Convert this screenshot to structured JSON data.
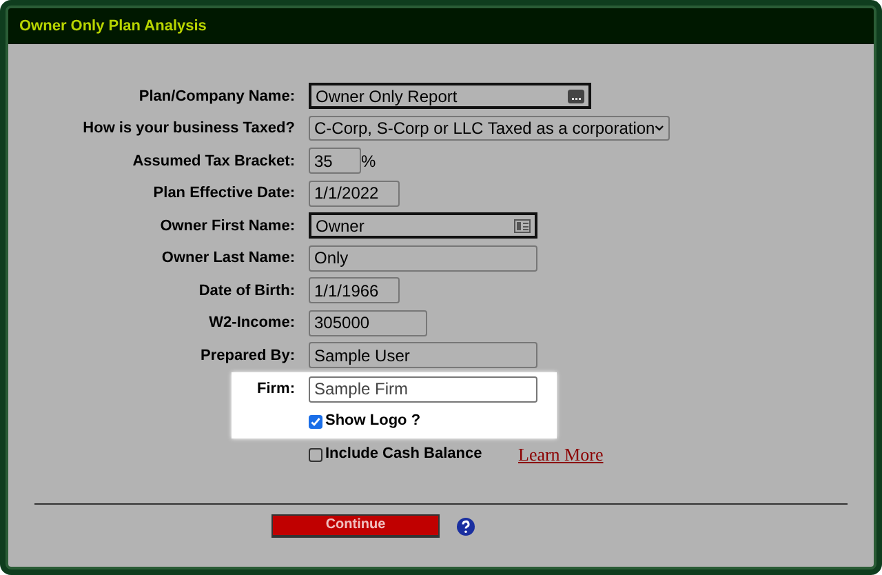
{
  "window": {
    "title": "Owner Only Plan Analysis"
  },
  "fields": [
    {
      "kind": "autofill",
      "label": "Plan/Company Name:",
      "value": "Owner Only Report",
      "highlighted": false
    },
    {
      "kind": "select",
      "label": "How is your business Taxed?",
      "value": "C-Corp, S-Corp or LLC Taxed as a corporation",
      "highlighted": false
    },
    {
      "kind": "text",
      "label": "Assumed Tax Bracket:",
      "value": "35",
      "suffix": "%",
      "highlighted": false
    },
    {
      "kind": "text",
      "label": "Plan Effective Date:",
      "value": "1/1/2022",
      "highlighted": false
    },
    {
      "kind": "contact",
      "label": "Owner First Name:",
      "value": "Owner",
      "highlighted": false
    },
    {
      "kind": "text",
      "label": "Owner Last Name:",
      "value": "Only",
      "highlighted": false
    },
    {
      "kind": "text",
      "label": "Date of Birth:",
      "value": "1/1/1966",
      "highlighted": false
    },
    {
      "kind": "text",
      "label": "W2-Income:",
      "value": "305000",
      "highlighted": false
    },
    {
      "kind": "text",
      "label": "Prepared By:",
      "value": "Sample User",
      "highlighted": false
    },
    {
      "kind": "text",
      "label": "Firm:",
      "value": "Sample Firm",
      "highlighted": true
    },
    {
      "kind": "checkbox",
      "label": "Show Logo ?",
      "checked": true,
      "highlighted": true
    },
    {
      "kind": "checkbox",
      "label": "Include Cash Balance",
      "checked": false,
      "highlighted": false,
      "link": "Learn More"
    }
  ],
  "continue_button": "Continue"
}
